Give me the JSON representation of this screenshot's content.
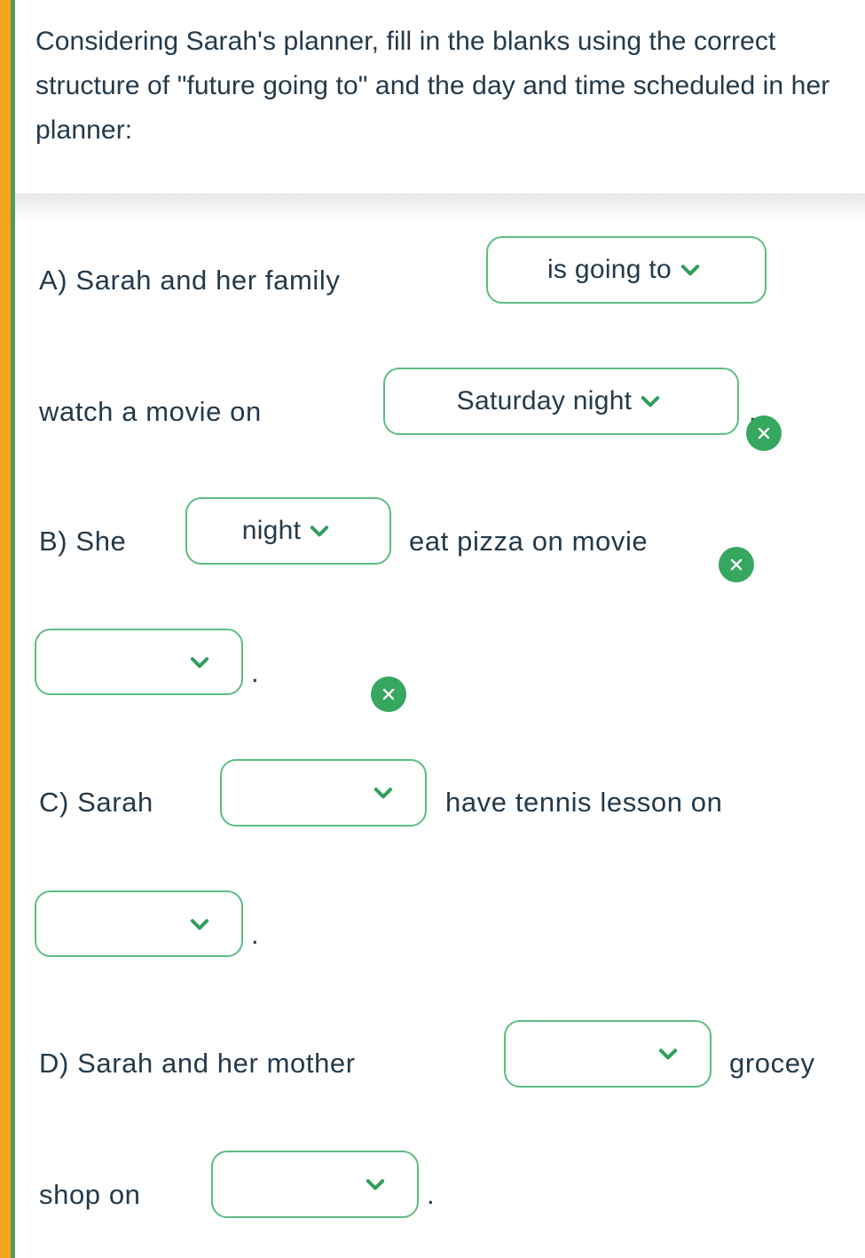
{
  "theme": {
    "accent_orange": "#f9a51a",
    "accent_green": "#559a5f",
    "border_green": "#5cbd82",
    "chevron_green": "#2e9e5b",
    "badge_green": "#36a75f",
    "text_color": "#24394b",
    "background": "#ffffff"
  },
  "header": {
    "prompt": "Considering Sarah's planner, fill in the blanks using the correct structure of \"future going to\" and the day and time scheduled in her planner:"
  },
  "icons": {
    "chevron_down": "chevron-down-icon",
    "clear": "close-icon"
  },
  "questions": [
    {
      "id": "A",
      "label": "A) Sarah and her family",
      "fragments": [
        "A) Sarah and her family",
        "watch a movie on"
      ],
      "blanks": [
        {
          "value": "is going to",
          "filled": true,
          "clearable": true,
          "placeholder": ""
        },
        {
          "value": "Saturday night",
          "filled": true,
          "clearable": true,
          "placeholder": ""
        }
      ],
      "trailing_punctuation": "."
    },
    {
      "id": "B",
      "label": "B) She",
      "fragments": [
        "B) She",
        "eat pizza on movie"
      ],
      "blanks": [
        {
          "value": "night",
          "filled": true,
          "clearable": true,
          "placeholder": ""
        },
        {
          "value": "",
          "filled": false,
          "clearable": false,
          "placeholder": ""
        }
      ],
      "trailing_punctuation": "."
    },
    {
      "id": "C",
      "label": "C) Sarah",
      "fragments": [
        "C) Sarah",
        "have tennis lesson on"
      ],
      "blanks": [
        {
          "value": "",
          "filled": false,
          "clearable": false,
          "placeholder": ""
        },
        {
          "value": "",
          "filled": false,
          "clearable": false,
          "placeholder": ""
        }
      ],
      "trailing_punctuation": "."
    },
    {
      "id": "D",
      "label": "D) Sarah and her mother",
      "fragments": [
        "D) Sarah and her mother",
        "grocey",
        "shop on"
      ],
      "blanks": [
        {
          "value": "",
          "filled": false,
          "clearable": false,
          "placeholder": ""
        },
        {
          "value": "",
          "filled": false,
          "clearable": false,
          "placeholder": ""
        }
      ],
      "trailing_punctuation": "."
    }
  ],
  "lines": {
    "a1_pre": "A) Sarah and her family",
    "a1_blank": "is going to",
    "a2_pre": "watch a movie on",
    "a2_blank": "Saturday night",
    "a2_dot": ".",
    "b1_pre": "B) She",
    "b1_blank": "night",
    "b1_post": "eat pizza on movie",
    "b2_dot": ".",
    "c1_pre": "C) Sarah",
    "c1_post": "have tennis lesson on",
    "c2_dot": ".",
    "d1_pre": "D) Sarah and her mother",
    "d1_post": "grocey",
    "d2_pre": "shop on",
    "d2_dot": "."
  }
}
